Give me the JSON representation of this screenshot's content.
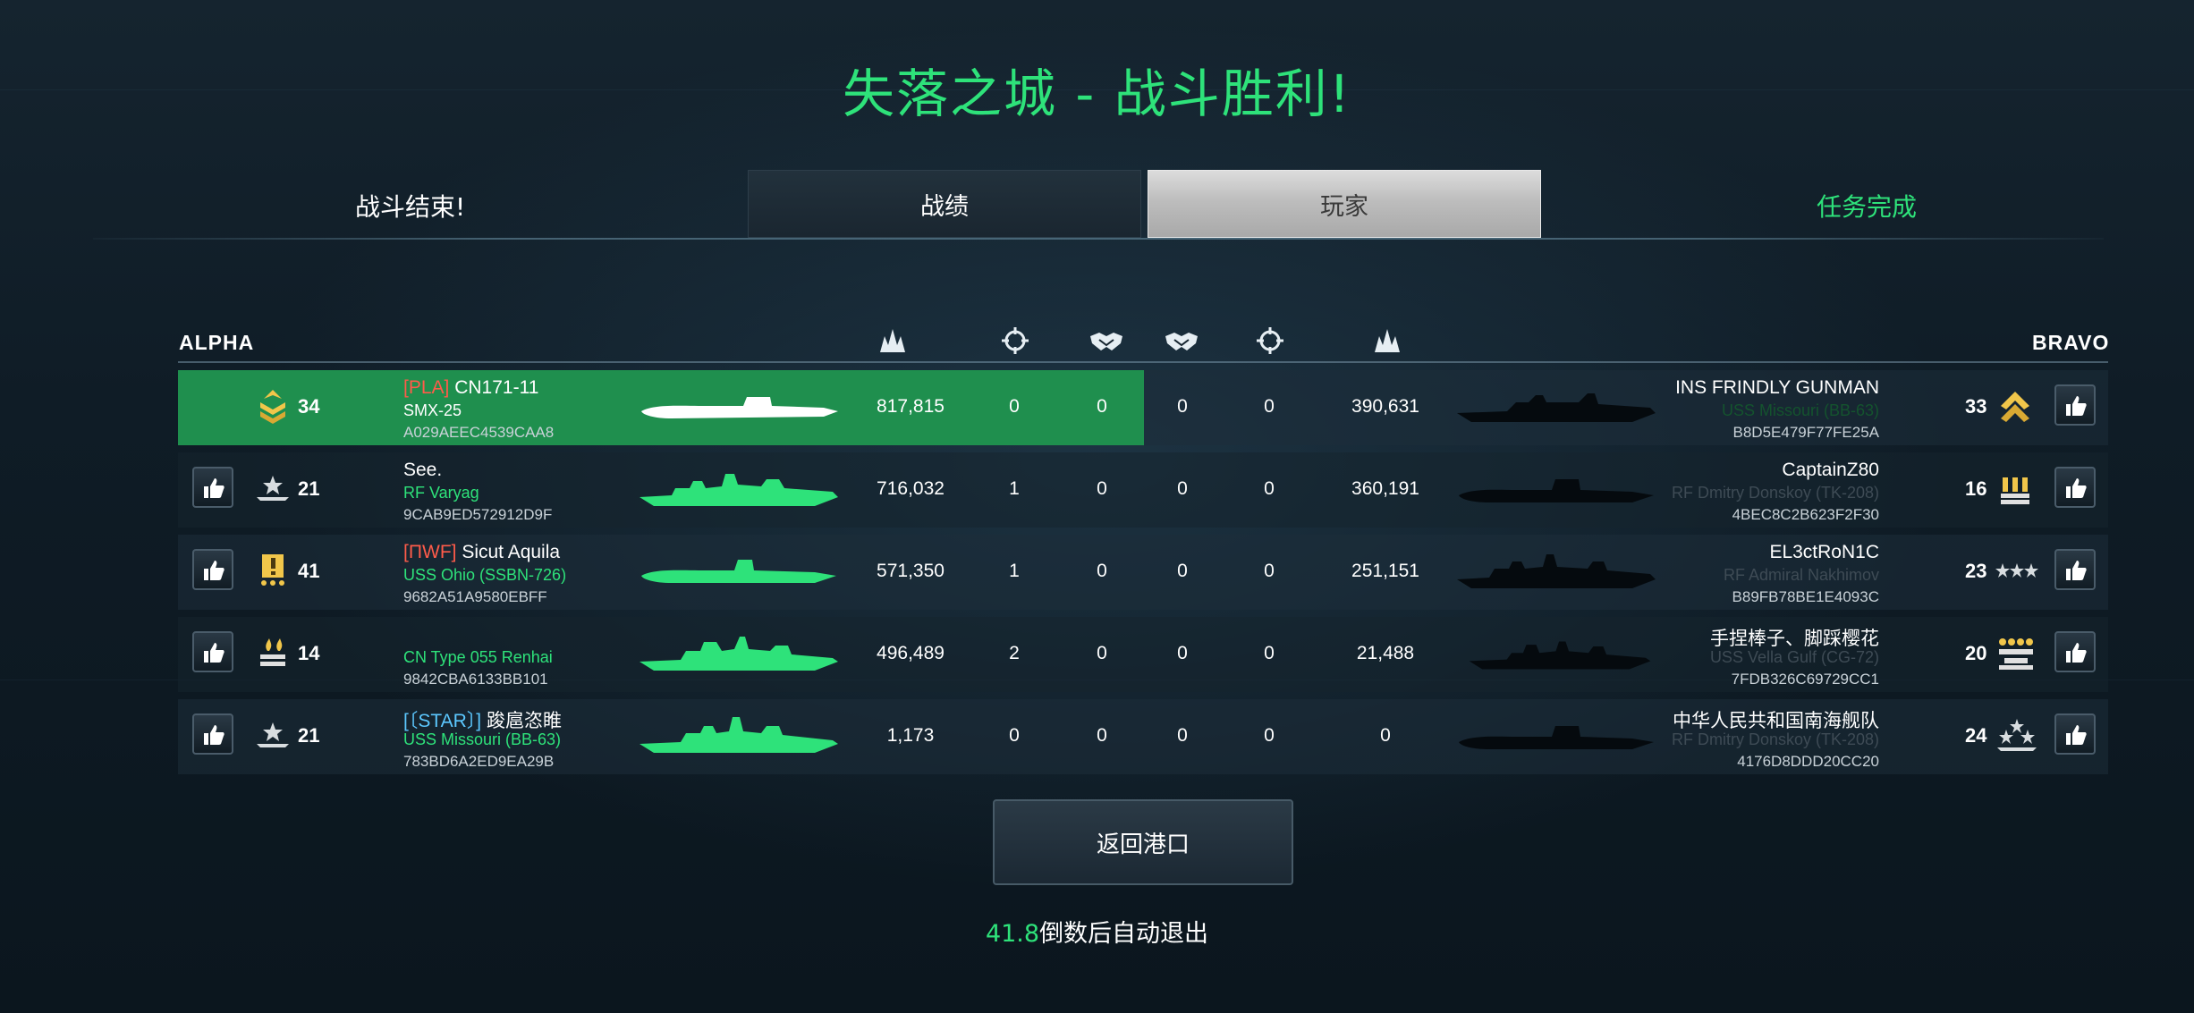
{
  "title": "失落之城 - 战斗胜利!",
  "tabs": {
    "battle_ended": "战斗结束!",
    "stats": "战绩",
    "players": "玩家",
    "mission_complete": "任务完成"
  },
  "teams": {
    "left": "ALPHA",
    "right": "BRAVO"
  },
  "column_icons": [
    "damage-icon",
    "crosshair-icon",
    "handshake-icon",
    "handshake-icon",
    "crosshair-icon",
    "damage-icon"
  ],
  "colors": {
    "accent_green": "#2ee27a",
    "mvp_row": "#1f8f4e",
    "clan_red": "#ff5b4a",
    "clan_blue": "#5cc8ff"
  },
  "rows": [
    {
      "left": {
        "level": "34",
        "rank_icon": "sergeant-gold-rank-icon",
        "clan": "[PLA]",
        "name": "CN171-11",
        "ship": "SMX-25",
        "id": "A029AEEC4539CAA8",
        "damage": "817,815",
        "kills": "0",
        "assists": "0",
        "mvp": true
      },
      "right": {
        "assists": "0",
        "kills": "0",
        "damage": "390,631",
        "name": "INS FRINDLY GUNMAN",
        "ship": "USS Missouri (BB-63)",
        "id": "B8D5E479F77FE25A",
        "level": "33",
        "rank_icon": "gold-chevron-rank-icon"
      }
    },
    {
      "left": {
        "level": "21",
        "rank_icon": "star-wings-rank-icon",
        "clan": "",
        "name": "See.",
        "ship": "RF Varyag",
        "id": "9CAB9ED572912D9F",
        "damage": "716,032",
        "kills": "1",
        "assists": "0"
      },
      "right": {
        "assists": "0",
        "kills": "0",
        "damage": "360,191",
        "name": "CaptainZ80",
        "ship": "RF Dmitry Donskoy (TK-208)",
        "id": "4BEC8C2B623F2F30",
        "level": "16",
        "rank_icon": "gold-bars-rank-icon"
      }
    },
    {
      "left": {
        "level": "41",
        "rank_icon": "exclamation-gold-rank-icon",
        "clan": "[ΠWF]",
        "name": "Sicut Aquila",
        "ship": "USS Ohio (SSBN-726)",
        "id": "9682A51A9580EBFF",
        "damage": "571,350",
        "kills": "1",
        "assists": "0"
      },
      "right": {
        "assists": "0",
        "kills": "0",
        "damage": "251,151",
        "name": "EL3ctRoN1C",
        "ship": "RF Admiral Nakhimov",
        "id": "B89FB78BE1E4093C",
        "level": "23",
        "rank_icon": "three-stars-rank-icon"
      }
    },
    {
      "left": {
        "level": "14",
        "rank_icon": "flames-rank-icon",
        "clan": "",
        "name": "",
        "ship": "CN Type 055 Renhai",
        "id": "9842CBA6133BB101",
        "damage": "496,489",
        "kills": "2",
        "assists": "0"
      },
      "right": {
        "assists": "0",
        "kills": "0",
        "damage": "21,488",
        "name": "手捏棒子、脚踩樱花",
        "ship": "USS Vella Gulf (CG-72)",
        "id": "7FDB326C69729CC1",
        "level": "20",
        "rank_icon": "gold-stars-bar-rank-icon"
      }
    },
    {
      "left": {
        "level": "21",
        "rank_icon": "star-wings-rank-icon",
        "clan": "[〔STAR〕]",
        "name": "踆扈恣睢",
        "ship": "USS Missouri (BB-63)",
        "id": "783BD6A2ED9EA29B",
        "damage": "1,173",
        "kills": "0",
        "assists": "0"
      },
      "right": {
        "assists": "0",
        "kills": "0",
        "damage": "0",
        "name": "中华人民共和国南海舰队",
        "ship": "RF Dmitry Donskoy (TK-208)",
        "id": "4176D8DDD20CC20",
        "level": "24",
        "rank_icon": "stars-wreath-rank-icon"
      }
    }
  ],
  "return_button": "返回港口",
  "countdown": {
    "seconds": "41.8",
    "suffix": "倒数后自动退出"
  }
}
